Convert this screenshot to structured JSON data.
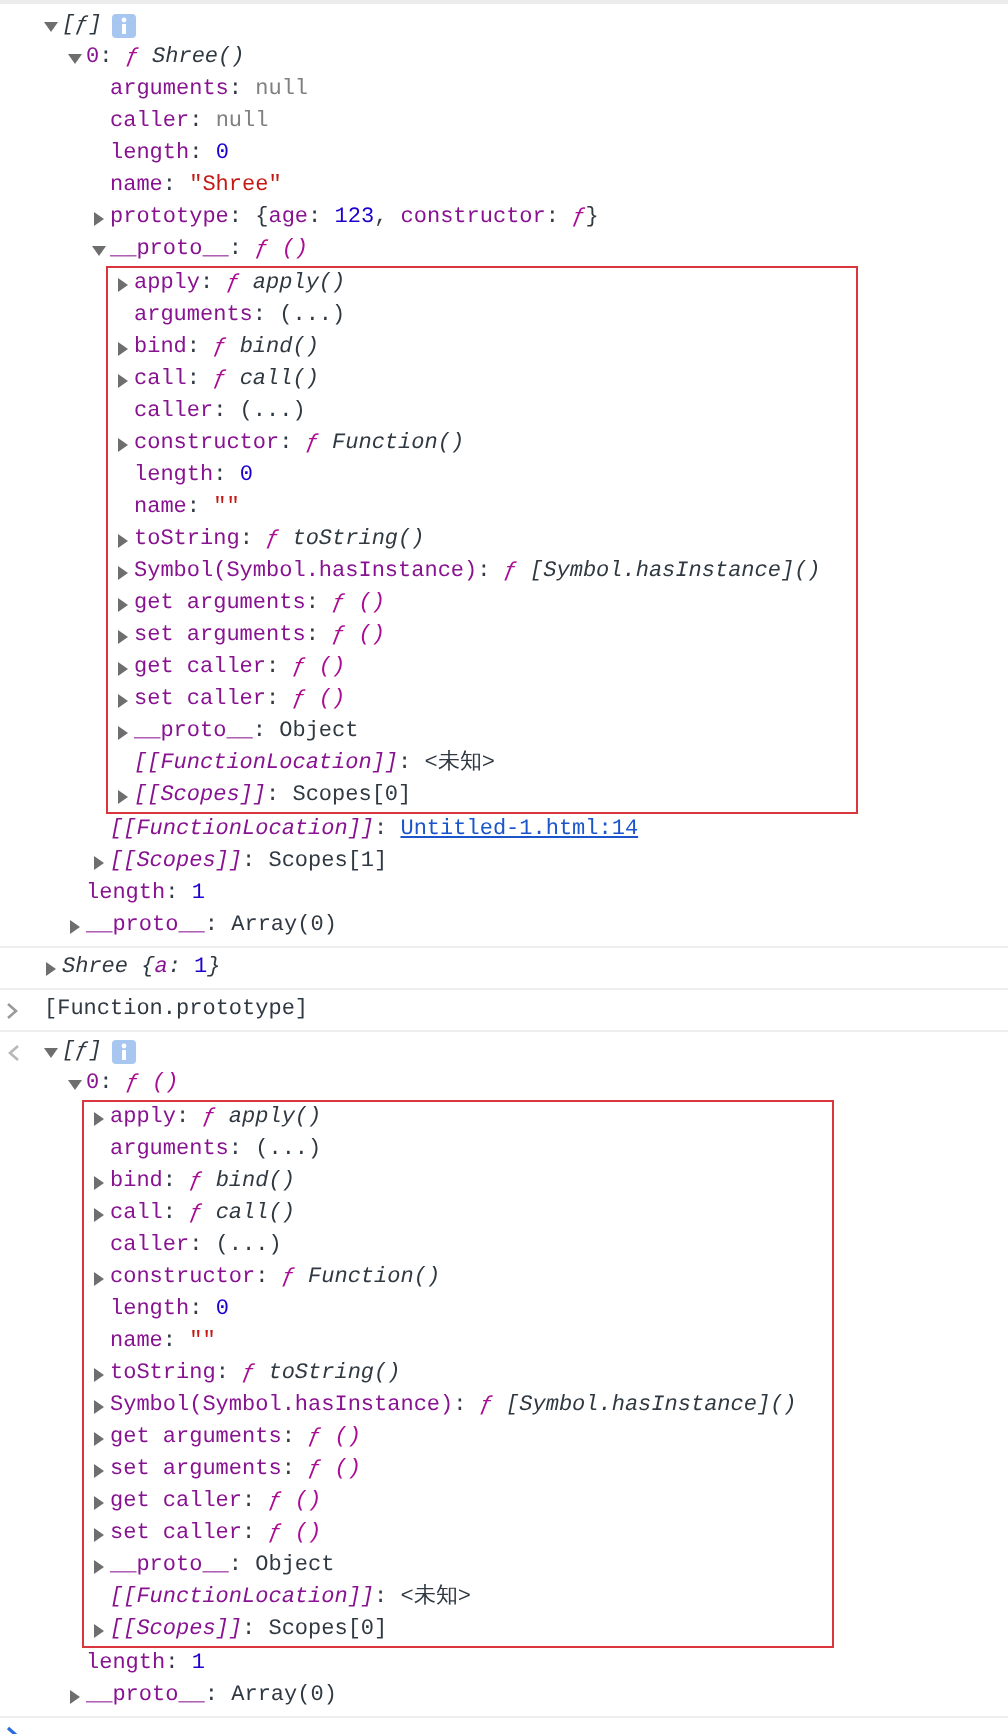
{
  "console": {
    "entries": [
      {
        "kind": "log",
        "rows": [
          {
            "parts": [
              {
                "text": "[ƒ]",
                "kind": "preview"
              }
            ],
            "expanded": true,
            "info": true,
            "children": [
              {
                "parts": [
                  {
                    "text": "0",
                    "kind": "key"
                  },
                  {
                    "text": ": ",
                    "kind": "plain"
                  },
                  {
                    "text": "ƒ ",
                    "kind": "func"
                  },
                  {
                    "text": "Shree()",
                    "kind": "fname"
                  }
                ],
                "expanded": true,
                "children": [
                  {
                    "parts": [
                      {
                        "text": "arguments",
                        "kind": "key"
                      },
                      {
                        "text": ": ",
                        "kind": "plain"
                      },
                      {
                        "text": "null",
                        "kind": "null"
                      }
                    ]
                  },
                  {
                    "parts": [
                      {
                        "text": "caller",
                        "kind": "key"
                      },
                      {
                        "text": ": ",
                        "kind": "plain"
                      },
                      {
                        "text": "null",
                        "kind": "null"
                      }
                    ]
                  },
                  {
                    "parts": [
                      {
                        "text": "length",
                        "kind": "key"
                      },
                      {
                        "text": ": ",
                        "kind": "plain"
                      },
                      {
                        "text": "0",
                        "kind": "num"
                      }
                    ]
                  },
                  {
                    "parts": [
                      {
                        "text": "name",
                        "kind": "key"
                      },
                      {
                        "text": ": ",
                        "kind": "plain"
                      },
                      {
                        "text": "\"Shree\"",
                        "kind": "str"
                      }
                    ]
                  },
                  {
                    "parts": [
                      {
                        "text": "prototype",
                        "kind": "key"
                      },
                      {
                        "text": ": {",
                        "kind": "plain"
                      },
                      {
                        "text": "age",
                        "kind": "key"
                      },
                      {
                        "text": ": ",
                        "kind": "plain"
                      },
                      {
                        "text": "123",
                        "kind": "num"
                      },
                      {
                        "text": ", ",
                        "kind": "plain"
                      },
                      {
                        "text": "constructor",
                        "kind": "key"
                      },
                      {
                        "text": ": ",
                        "kind": "plain"
                      },
                      {
                        "text": "ƒ",
                        "kind": "func"
                      },
                      {
                        "text": "}",
                        "kind": "plain"
                      }
                    ],
                    "expanded": false
                  },
                  {
                    "parts": [
                      {
                        "text": "__proto__",
                        "kind": "key"
                      },
                      {
                        "text": ": ",
                        "kind": "plain"
                      },
                      {
                        "text": "ƒ ()",
                        "kind": "func"
                      }
                    ],
                    "expanded": true,
                    "boxed": true,
                    "children": [
                      {
                        "parts": [
                          {
                            "text": "apply",
                            "kind": "key"
                          },
                          {
                            "text": ": ",
                            "kind": "plain"
                          },
                          {
                            "text": "ƒ ",
                            "kind": "func"
                          },
                          {
                            "text": "apply()",
                            "kind": "fname"
                          }
                        ],
                        "expanded": false
                      },
                      {
                        "parts": [
                          {
                            "text": "arguments",
                            "kind": "key"
                          },
                          {
                            "text": ": (...)",
                            "kind": "plain"
                          }
                        ]
                      },
                      {
                        "parts": [
                          {
                            "text": "bind",
                            "kind": "key"
                          },
                          {
                            "text": ": ",
                            "kind": "plain"
                          },
                          {
                            "text": "ƒ ",
                            "kind": "func"
                          },
                          {
                            "text": "bind()",
                            "kind": "fname"
                          }
                        ],
                        "expanded": false
                      },
                      {
                        "parts": [
                          {
                            "text": "call",
                            "kind": "key"
                          },
                          {
                            "text": ": ",
                            "kind": "plain"
                          },
                          {
                            "text": "ƒ ",
                            "kind": "func"
                          },
                          {
                            "text": "call()",
                            "kind": "fname"
                          }
                        ],
                        "expanded": false
                      },
                      {
                        "parts": [
                          {
                            "text": "caller",
                            "kind": "key"
                          },
                          {
                            "text": ": (...)",
                            "kind": "plain"
                          }
                        ]
                      },
                      {
                        "parts": [
                          {
                            "text": "constructor",
                            "kind": "key"
                          },
                          {
                            "text": ": ",
                            "kind": "plain"
                          },
                          {
                            "text": "ƒ ",
                            "kind": "func"
                          },
                          {
                            "text": "Function()",
                            "kind": "fname"
                          }
                        ],
                        "expanded": false
                      },
                      {
                        "parts": [
                          {
                            "text": "length",
                            "kind": "key"
                          },
                          {
                            "text": ": ",
                            "kind": "plain"
                          },
                          {
                            "text": "0",
                            "kind": "num"
                          }
                        ]
                      },
                      {
                        "parts": [
                          {
                            "text": "name",
                            "kind": "key"
                          },
                          {
                            "text": ": ",
                            "kind": "plain"
                          },
                          {
                            "text": "\"\"",
                            "kind": "str"
                          }
                        ]
                      },
                      {
                        "parts": [
                          {
                            "text": "toString",
                            "kind": "key"
                          },
                          {
                            "text": ": ",
                            "kind": "plain"
                          },
                          {
                            "text": "ƒ ",
                            "kind": "func"
                          },
                          {
                            "text": "toString()",
                            "kind": "fname"
                          }
                        ],
                        "expanded": false
                      },
                      {
                        "parts": [
                          {
                            "text": "Symbol(Symbol.hasInstance)",
                            "kind": "key"
                          },
                          {
                            "text": ": ",
                            "kind": "plain"
                          },
                          {
                            "text": "ƒ ",
                            "kind": "func"
                          },
                          {
                            "text": "[Symbol.hasInstance]()",
                            "kind": "fname"
                          }
                        ],
                        "expanded": false
                      },
                      {
                        "parts": [
                          {
                            "text": "get arguments",
                            "kind": "key"
                          },
                          {
                            "text": ": ",
                            "kind": "plain"
                          },
                          {
                            "text": "ƒ ()",
                            "kind": "func"
                          }
                        ],
                        "expanded": false
                      },
                      {
                        "parts": [
                          {
                            "text": "set arguments",
                            "kind": "key"
                          },
                          {
                            "text": ": ",
                            "kind": "plain"
                          },
                          {
                            "text": "ƒ ()",
                            "kind": "func"
                          }
                        ],
                        "expanded": false
                      },
                      {
                        "parts": [
                          {
                            "text": "get caller",
                            "kind": "key"
                          },
                          {
                            "text": ": ",
                            "kind": "plain"
                          },
                          {
                            "text": "ƒ ()",
                            "kind": "func"
                          }
                        ],
                        "expanded": false
                      },
                      {
                        "parts": [
                          {
                            "text": "set caller",
                            "kind": "key"
                          },
                          {
                            "text": ": ",
                            "kind": "plain"
                          },
                          {
                            "text": "ƒ ()",
                            "kind": "func"
                          }
                        ],
                        "expanded": false
                      },
                      {
                        "parts": [
                          {
                            "text": "__proto__",
                            "kind": "key"
                          },
                          {
                            "text": ": Object",
                            "kind": "plain"
                          }
                        ],
                        "expanded": false
                      },
                      {
                        "parts": [
                          {
                            "text": "[[FunctionLocation]]",
                            "kind": "internal"
                          },
                          {
                            "text": ": <未知>",
                            "kind": "plain"
                          }
                        ]
                      },
                      {
                        "parts": [
                          {
                            "text": "[[Scopes]]",
                            "kind": "internal"
                          },
                          {
                            "text": ": Scopes[0]",
                            "kind": "plain"
                          }
                        ],
                        "expanded": false
                      }
                    ]
                  },
                  {
                    "parts": [
                      {
                        "text": "[[FunctionLocation]]",
                        "kind": "internal"
                      },
                      {
                        "text": ": ",
                        "kind": "plain"
                      },
                      {
                        "text": "Untitled-1.html:14",
                        "kind": "link"
                      }
                    ]
                  },
                  {
                    "parts": [
                      {
                        "text": "[[Scopes]]",
                        "kind": "internal"
                      },
                      {
                        "text": ": Scopes[1]",
                        "kind": "plain"
                      }
                    ],
                    "expanded": false
                  }
                ]
              },
              {
                "parts": [
                  {
                    "text": "length",
                    "kind": "key"
                  },
                  {
                    "text": ": ",
                    "kind": "plain"
                  },
                  {
                    "text": "1",
                    "kind": "num"
                  }
                ]
              },
              {
                "parts": [
                  {
                    "text": "__proto__",
                    "kind": "key"
                  },
                  {
                    "text": ": Array(0)",
                    "kind": "plain"
                  }
                ],
                "expanded": false
              }
            ]
          }
        ]
      },
      {
        "kind": "log",
        "rows": [
          {
            "parts": [
              {
                "text": "Shree {",
                "kind": "preview"
              },
              {
                "text": "a",
                "kind": "ikey"
              },
              {
                "text": ": ",
                "kind": "preview"
              },
              {
                "text": "1",
                "kind": "num"
              },
              {
                "text": "}",
                "kind": "preview"
              }
            ],
            "expanded": false
          }
        ]
      },
      {
        "kind": "input",
        "text": "[Function.prototype]"
      },
      {
        "kind": "result",
        "rows": [
          {
            "parts": [
              {
                "text": "[ƒ]",
                "kind": "preview"
              }
            ],
            "expanded": true,
            "info": true,
            "children": [
              {
                "parts": [
                  {
                    "text": "0",
                    "kind": "key"
                  },
                  {
                    "text": ": ",
                    "kind": "plain"
                  },
                  {
                    "text": "ƒ ()",
                    "kind": "func"
                  }
                ],
                "expanded": true,
                "boxed": true,
                "children": [
                  {
                    "parts": [
                      {
                        "text": "apply",
                        "kind": "key"
                      },
                      {
                        "text": ": ",
                        "kind": "plain"
                      },
                      {
                        "text": "ƒ ",
                        "kind": "func"
                      },
                      {
                        "text": "apply()",
                        "kind": "fname"
                      }
                    ],
                    "expanded": false
                  },
                  {
                    "parts": [
                      {
                        "text": "arguments",
                        "kind": "key"
                      },
                      {
                        "text": ": (...)",
                        "kind": "plain"
                      }
                    ]
                  },
                  {
                    "parts": [
                      {
                        "text": "bind",
                        "kind": "key"
                      },
                      {
                        "text": ": ",
                        "kind": "plain"
                      },
                      {
                        "text": "ƒ ",
                        "kind": "func"
                      },
                      {
                        "text": "bind()",
                        "kind": "fname"
                      }
                    ],
                    "expanded": false
                  },
                  {
                    "parts": [
                      {
                        "text": "call",
                        "kind": "key"
                      },
                      {
                        "text": ": ",
                        "kind": "plain"
                      },
                      {
                        "text": "ƒ ",
                        "kind": "func"
                      },
                      {
                        "text": "call()",
                        "kind": "fname"
                      }
                    ],
                    "expanded": false
                  },
                  {
                    "parts": [
                      {
                        "text": "caller",
                        "kind": "key"
                      },
                      {
                        "text": ": (...)",
                        "kind": "plain"
                      }
                    ]
                  },
                  {
                    "parts": [
                      {
                        "text": "constructor",
                        "kind": "key"
                      },
                      {
                        "text": ": ",
                        "kind": "plain"
                      },
                      {
                        "text": "ƒ ",
                        "kind": "func"
                      },
                      {
                        "text": "Function()",
                        "kind": "fname"
                      }
                    ],
                    "expanded": false
                  },
                  {
                    "parts": [
                      {
                        "text": "length",
                        "kind": "key"
                      },
                      {
                        "text": ": ",
                        "kind": "plain"
                      },
                      {
                        "text": "0",
                        "kind": "num"
                      }
                    ]
                  },
                  {
                    "parts": [
                      {
                        "text": "name",
                        "kind": "key"
                      },
                      {
                        "text": ": ",
                        "kind": "plain"
                      },
                      {
                        "text": "\"\"",
                        "kind": "str"
                      }
                    ]
                  },
                  {
                    "parts": [
                      {
                        "text": "toString",
                        "kind": "key"
                      },
                      {
                        "text": ": ",
                        "kind": "plain"
                      },
                      {
                        "text": "ƒ ",
                        "kind": "func"
                      },
                      {
                        "text": "toString()",
                        "kind": "fname"
                      }
                    ],
                    "expanded": false
                  },
                  {
                    "parts": [
                      {
                        "text": "Symbol(Symbol.hasInstance)",
                        "kind": "key"
                      },
                      {
                        "text": ": ",
                        "kind": "plain"
                      },
                      {
                        "text": "ƒ ",
                        "kind": "func"
                      },
                      {
                        "text": "[Symbol.hasInstance]()",
                        "kind": "fname"
                      }
                    ],
                    "expanded": false
                  },
                  {
                    "parts": [
                      {
                        "text": "get arguments",
                        "kind": "key"
                      },
                      {
                        "text": ": ",
                        "kind": "plain"
                      },
                      {
                        "text": "ƒ ()",
                        "kind": "func"
                      }
                    ],
                    "expanded": false
                  },
                  {
                    "parts": [
                      {
                        "text": "set arguments",
                        "kind": "key"
                      },
                      {
                        "text": ": ",
                        "kind": "plain"
                      },
                      {
                        "text": "ƒ ()",
                        "kind": "func"
                      }
                    ],
                    "expanded": false
                  },
                  {
                    "parts": [
                      {
                        "text": "get caller",
                        "kind": "key"
                      },
                      {
                        "text": ": ",
                        "kind": "plain"
                      },
                      {
                        "text": "ƒ ()",
                        "kind": "func"
                      }
                    ],
                    "expanded": false
                  },
                  {
                    "parts": [
                      {
                        "text": "set caller",
                        "kind": "key"
                      },
                      {
                        "text": ": ",
                        "kind": "plain"
                      },
                      {
                        "text": "ƒ ()",
                        "kind": "func"
                      }
                    ],
                    "expanded": false
                  },
                  {
                    "parts": [
                      {
                        "text": "__proto__",
                        "kind": "key"
                      },
                      {
                        "text": ": Object",
                        "kind": "plain"
                      }
                    ],
                    "expanded": false
                  },
                  {
                    "parts": [
                      {
                        "text": "[[FunctionLocation]]",
                        "kind": "internal"
                      },
                      {
                        "text": ": <未知>",
                        "kind": "plain"
                      }
                    ]
                  },
                  {
                    "parts": [
                      {
                        "text": "[[Scopes]]",
                        "kind": "internal"
                      },
                      {
                        "text": ": Scopes[0]",
                        "kind": "plain"
                      }
                    ],
                    "expanded": false
                  }
                ]
              },
              {
                "parts": [
                  {
                    "text": "length",
                    "kind": "key"
                  },
                  {
                    "text": ": ",
                    "kind": "plain"
                  },
                  {
                    "text": "1",
                    "kind": "num"
                  }
                ]
              },
              {
                "parts": [
                  {
                    "text": "__proto__",
                    "kind": "key"
                  },
                  {
                    "text": ": Array(0)",
                    "kind": "plain"
                  }
                ],
                "expanded": false
              }
            ]
          }
        ]
      },
      {
        "kind": "prompt"
      }
    ]
  }
}
